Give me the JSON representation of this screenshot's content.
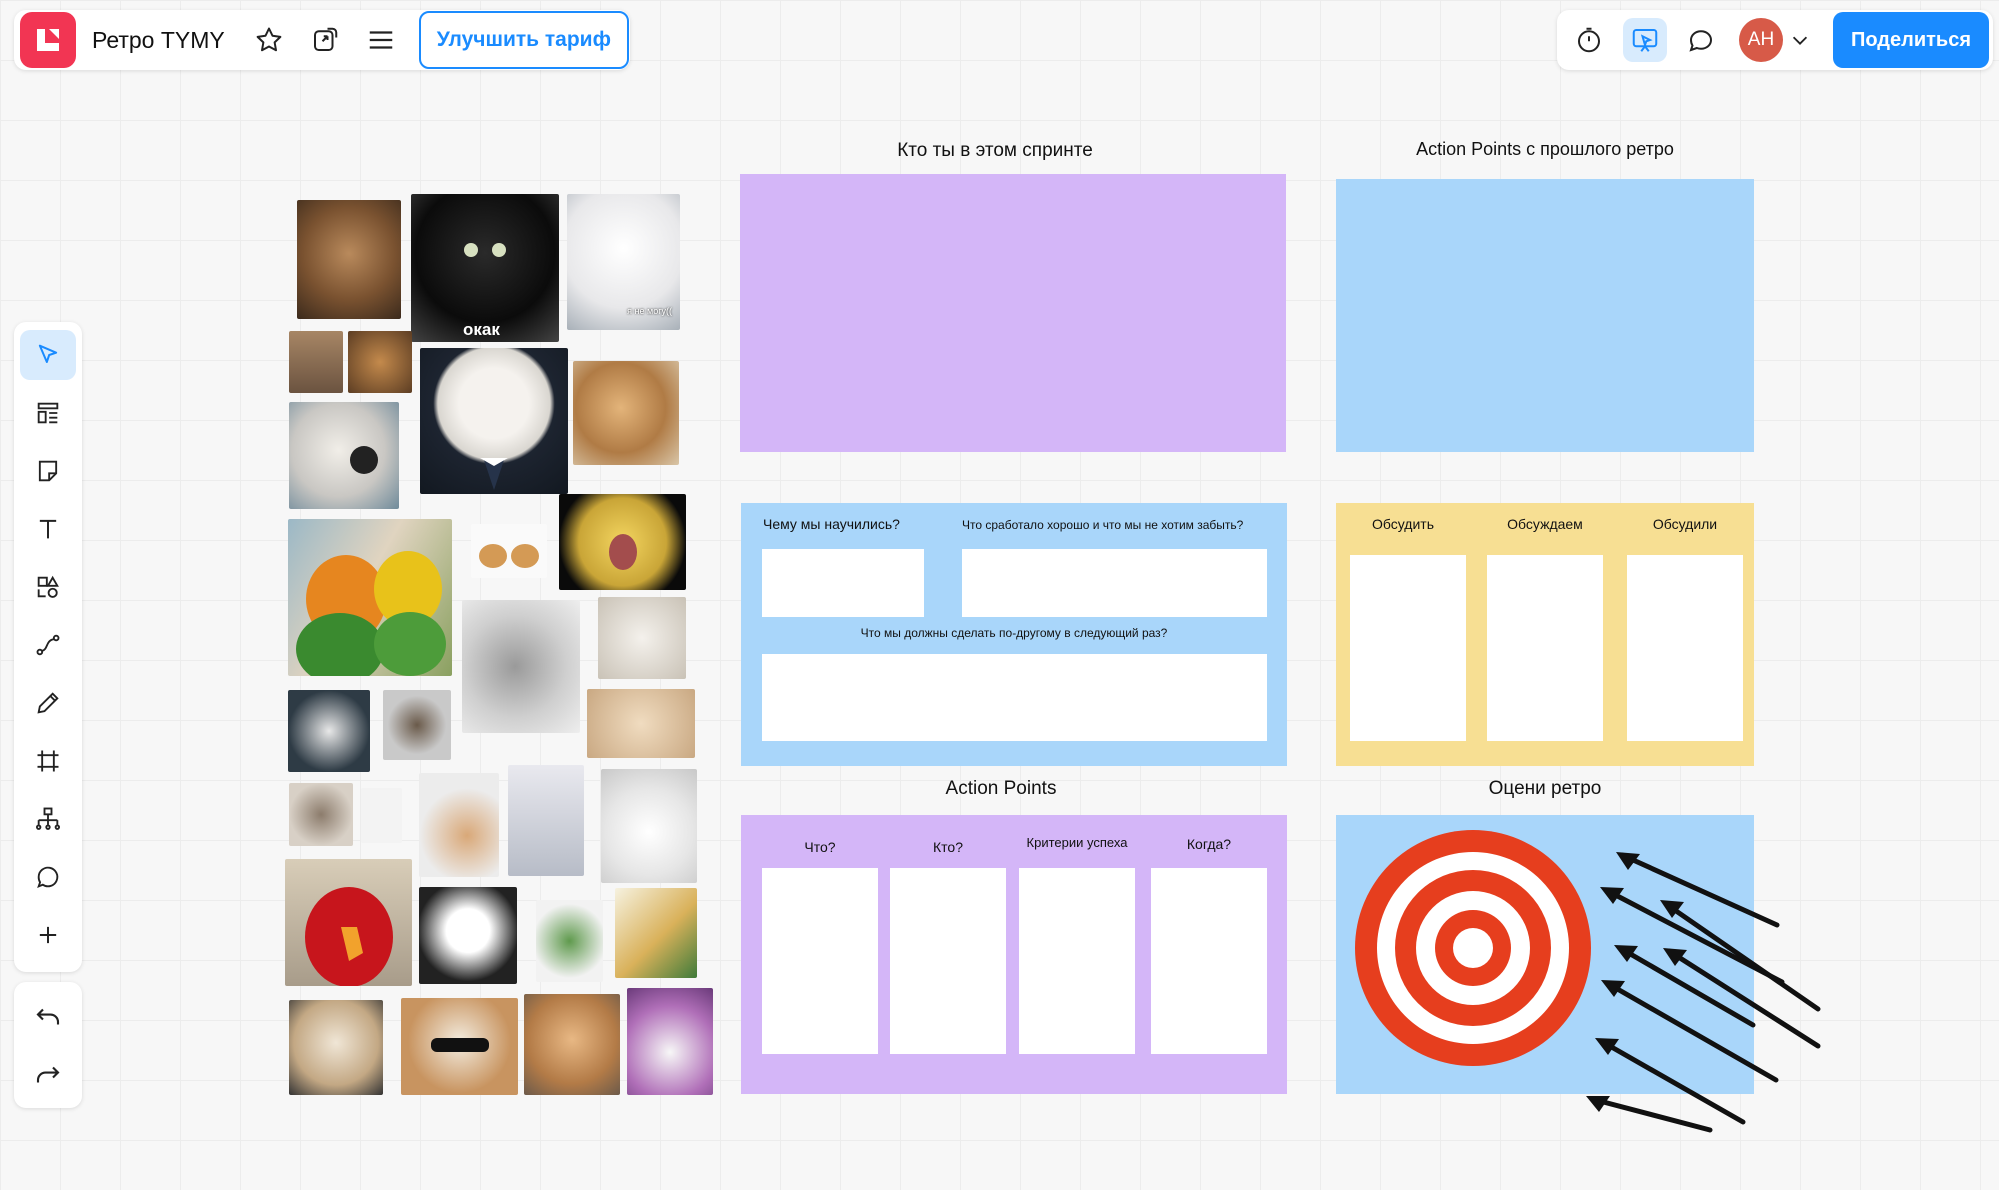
{
  "app": {
    "board_title": "Ретро TYMY",
    "upgrade_label": "Улучшить тариф",
    "share_label": "Поделиться",
    "avatar_initials": "АН"
  },
  "toolbar": {
    "tools": [
      "select",
      "templates",
      "sticky-note",
      "text",
      "shapes",
      "connector",
      "pen",
      "frame",
      "mind-map",
      "comment",
      "add"
    ]
  },
  "board": {
    "who_title": "Кто ты в этом спринте",
    "prev_ap_title": "Action Points с прошлого ретро",
    "learned": {
      "q1": "Чему мы научились?",
      "q2": "Что сработало хорошо и что мы не хотим забыть?",
      "q3": "Что мы должны сделать по-другому в следующий раз?"
    },
    "kanban": {
      "col1": "Обсудить",
      "col2": "Обсуждаем",
      "col3": "Обсудили"
    },
    "action_points": {
      "title": "Action Points",
      "col1": "Что?",
      "col2": "Кто?",
      "col3": "Критерии успеха",
      "col4": "Когда?"
    },
    "rate_title": "Оцени ретро"
  },
  "memes": {
    "okak": "окак",
    "cant": "я не могу(("
  },
  "colors": {
    "purple": "#d4b6f8",
    "blue": "#a9d6fa",
    "yellow": "#f7df93",
    "accent": "#1a8bff",
    "logo": "#f23553"
  }
}
